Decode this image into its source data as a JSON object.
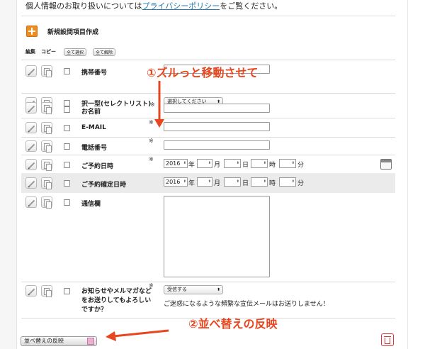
{
  "notice": {
    "prefix": "個人情報のお取り扱いについては",
    "link": "プライバシーポリシー",
    "suffix": "をご覧ください。"
  },
  "toolbar": {
    "new_item_label": "新規設問項目作成",
    "col_edit": "編集",
    "col_copy": "コピー",
    "select_all": "全て選択",
    "deselect_all": "全て解除"
  },
  "rows": {
    "phone": {
      "label": "携帯番号"
    },
    "select_type": {
      "label": "択一型(セレクトリスト)",
      "select_value": "選択してください"
    },
    "name": {
      "label": "お名前",
      "required": "※"
    },
    "email": {
      "label": "E-MAIL",
      "required": "※"
    },
    "tel": {
      "label": "電話番号",
      "required": "※"
    },
    "reservation": {
      "label": "ご予約日時",
      "required": "※",
      "year": "2016",
      "u_year": "年",
      "u_month": "月",
      "u_day": "日",
      "u_hour": "時",
      "u_min": "分"
    },
    "confirmed": {
      "label": "ご予約確定日時",
      "year": "2016",
      "u_year": "年",
      "u_month": "月",
      "u_day": "日",
      "u_hour": "時",
      "u_min": "分"
    },
    "comment": {
      "label": "通信欄"
    },
    "newsletter": {
      "label": "お知らせやメルマガなどをお送りしてもよろしいですか？",
      "required": "※",
      "select_value": "受信する",
      "note": "ご迷惑になるような頻繁な宣伝メールはお送りしません！"
    }
  },
  "annotations": {
    "step1": "①ズルっと移動させて",
    "step2": "②並べ替えの反映"
  },
  "footer": {
    "reflect_button": "並べ替えの反映"
  },
  "colors": {
    "annotation_red": "#e8461e",
    "link": "#2a7ab0",
    "add_orange": "#f08c1b"
  },
  "icons": [
    "plus-icon",
    "pencil-icon",
    "copy-icon",
    "calendar-icon",
    "trash-icon",
    "sort-icon"
  ]
}
